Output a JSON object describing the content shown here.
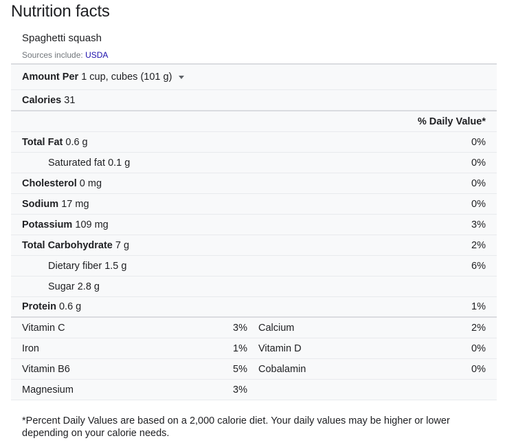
{
  "title": "Nutrition facts",
  "food_name": "Spaghetti squash",
  "sources": {
    "label": "Sources include:",
    "link": "USDA"
  },
  "serving": {
    "label": "Amount Per",
    "value": "1 cup, cubes (101 g)"
  },
  "calories": {
    "label": "Calories",
    "value": "31"
  },
  "daily_value_header": "% Daily Value*",
  "nutrients": [
    {
      "label": "Total Fat",
      "amount": "0.6 g",
      "pct": "0%",
      "bold": true
    },
    {
      "label": "Saturated fat",
      "amount": "0.1 g",
      "pct": "0%",
      "bold": false
    },
    {
      "label": "Cholesterol",
      "amount": "0 mg",
      "pct": "0%",
      "bold": true
    },
    {
      "label": "Sodium",
      "amount": "17 mg",
      "pct": "0%",
      "bold": true
    },
    {
      "label": "Potassium",
      "amount": "109 mg",
      "pct": "3%",
      "bold": true
    },
    {
      "label": "Total Carbohydrate",
      "amount": "7 g",
      "pct": "2%",
      "bold": true
    },
    {
      "label": "Dietary fiber",
      "amount": "1.5 g",
      "pct": "6%",
      "bold": false
    },
    {
      "label": "Sugar",
      "amount": "2.8 g",
      "pct": "",
      "bold": false
    },
    {
      "label": "Protein",
      "amount": "0.6 g",
      "pct": "1%",
      "bold": true
    }
  ],
  "vitamins": [
    {
      "left": {
        "label": "Vitamin C",
        "pct": "3%"
      },
      "right": {
        "label": "Calcium",
        "pct": "2%"
      }
    },
    {
      "left": {
        "label": "Iron",
        "pct": "1%"
      },
      "right": {
        "label": "Vitamin D",
        "pct": "0%"
      }
    },
    {
      "left": {
        "label": "Vitamin B6",
        "pct": "5%"
      },
      "right": {
        "label": "Cobalamin",
        "pct": "0%"
      }
    },
    {
      "left": {
        "label": "Magnesium",
        "pct": "3%"
      },
      "right": {
        "label": "",
        "pct": ""
      }
    }
  ],
  "footnote": "*Percent Daily Values are based on a 2,000 calorie diet. Your daily values may be higher or lower depending on your calorie needs.",
  "colors": {
    "link": "#1a0dab",
    "table_bg": "#f8f9fa",
    "divider": "#dadce0"
  }
}
